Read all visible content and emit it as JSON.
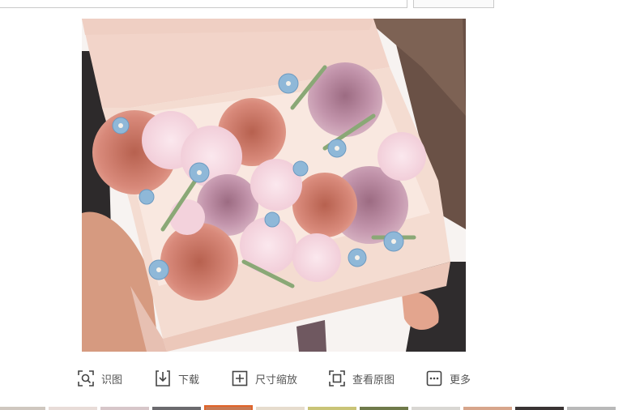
{
  "search_bar": {
    "value": ""
  },
  "image": {
    "description_icon": "flower-box-photo-icon"
  },
  "toolbar": {
    "items": [
      {
        "label": "识图",
        "icon": "image-search-icon"
      },
      {
        "label": "下载",
        "icon": "download-icon"
      },
      {
        "label": "尺寸缩放",
        "icon": "resize-icon"
      },
      {
        "label": "查看原图",
        "icon": "view-original-icon"
      },
      {
        "label": "更多",
        "icon": "more-icon"
      }
    ]
  },
  "colors": {
    "accent_selected_thumb": "#e0642a",
    "toolbar_text": "#555555",
    "icon_stroke": "#444444"
  },
  "filmstrip": {
    "selected_index": 4,
    "thumbs": [
      {
        "color": "#cfc7bf"
      },
      {
        "color": "#e8dcd8"
      },
      {
        "color": "#d7c6c9"
      },
      {
        "color": "#6b6a6e"
      },
      {
        "color": "#c77a55"
      },
      {
        "color": "#e6dccd"
      },
      {
        "color": "#c9c477"
      },
      {
        "color": "#6f7a4a"
      },
      {
        "color": "#d9d7d3"
      },
      {
        "color": "#d7a58b"
      },
      {
        "color": "#3a3434"
      },
      {
        "color": "#b9b9b9"
      }
    ]
  }
}
